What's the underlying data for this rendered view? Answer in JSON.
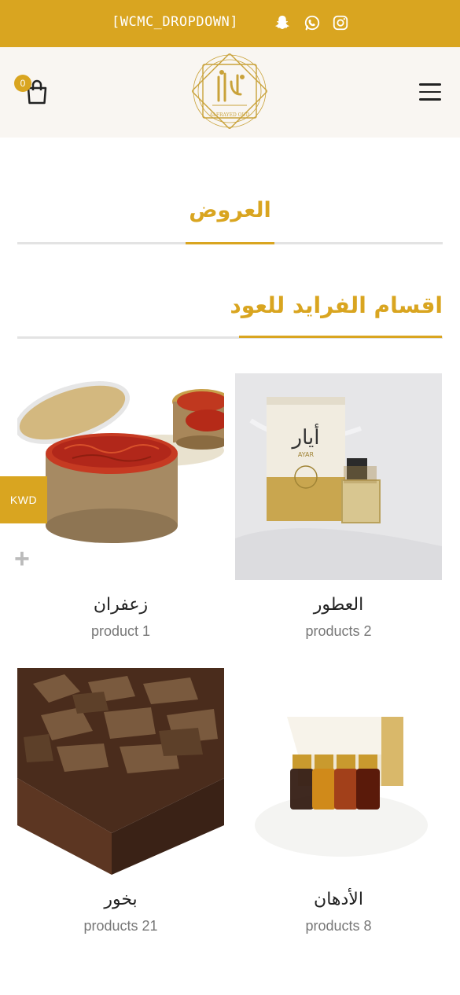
{
  "topbar": {
    "dropdown_text": "[WCMC_DROPDOWN]",
    "icons": [
      "snapchat-icon",
      "whatsapp-icon",
      "instagram-icon"
    ],
    "background": "#d9a520"
  },
  "header": {
    "cart_count": "0",
    "logo_text": "ALFRAYED OUD",
    "icons": [
      "cart-icon",
      "hamburger-menu-icon"
    ]
  },
  "sections": {
    "offers_title": "العروض",
    "categories_title": "اقسام الفرايد للعود"
  },
  "categories": [
    {
      "name": "زعفران",
      "count": "product 1"
    },
    {
      "name": "العطور",
      "count": "products 2"
    },
    {
      "name": "بخور",
      "count": "products 21"
    },
    {
      "name": "الأدهان",
      "count": "products 8"
    }
  ],
  "currency": {
    "label": "KWD"
  },
  "accent_color": "#d9a520"
}
